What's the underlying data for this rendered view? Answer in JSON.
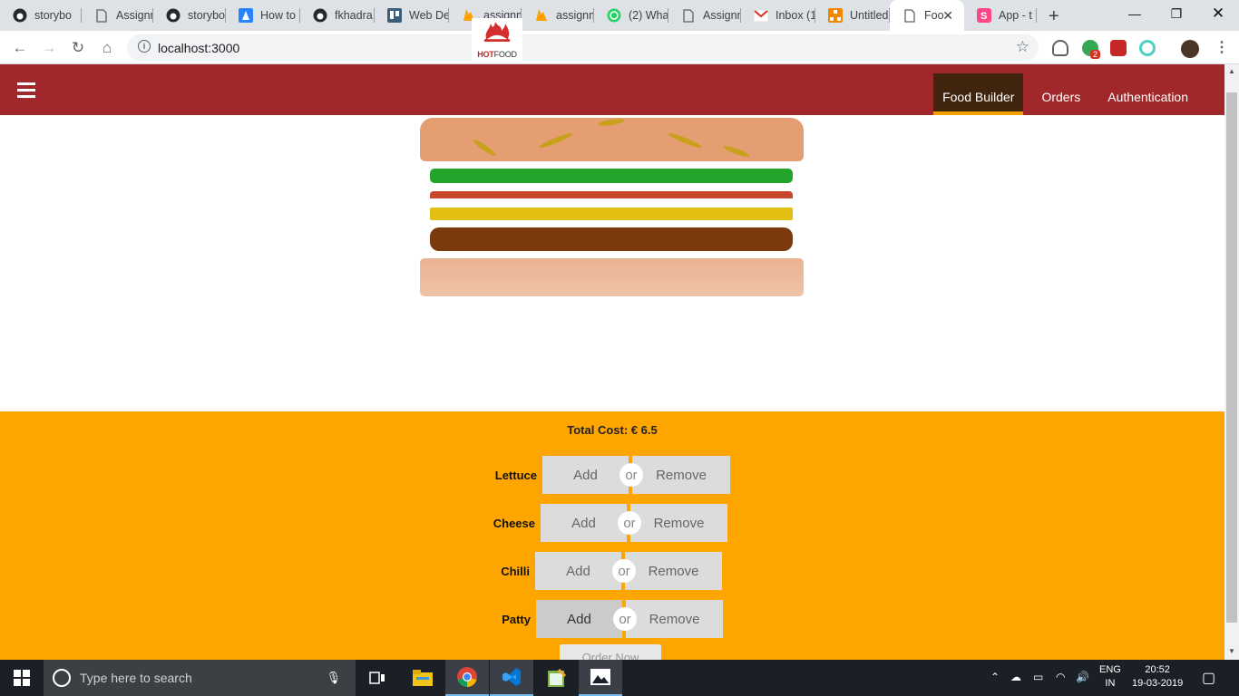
{
  "browser": {
    "tabs": [
      {
        "label": "storybo",
        "icon": "github-icon"
      },
      {
        "label": "Assignn",
        "icon": "page-icon"
      },
      {
        "label": "storybo",
        "icon": "github-icon"
      },
      {
        "label": "How to",
        "icon": "atlassian-icon"
      },
      {
        "label": "fkhadra",
        "icon": "github-icon"
      },
      {
        "label": "Web De",
        "icon": "trello-icon"
      },
      {
        "label": "assignm",
        "icon": "firebase-icon"
      },
      {
        "label": "assignm",
        "icon": "firebase-icon"
      },
      {
        "label": "(2) Wha",
        "icon": "whatsapp-icon"
      },
      {
        "label": "Assignn",
        "icon": "page-icon"
      },
      {
        "label": "Inbox (1",
        "icon": "gmail-icon"
      },
      {
        "label": "Untitled",
        "icon": "drawio-icon"
      },
      {
        "label": "Foo",
        "icon": "page-icon"
      },
      {
        "label": "App - t",
        "icon": "storybook-icon"
      }
    ],
    "new_tab": "+",
    "url": "localhost:3000",
    "extension_badge": "2"
  },
  "app": {
    "logo_hot": "HOT",
    "logo_food": "FOOD",
    "nav": [
      {
        "label": "Food Builder",
        "active": true
      },
      {
        "label": "Orders",
        "active": false
      },
      {
        "label": "Authentication",
        "active": false
      }
    ],
    "total_cost": "Total Cost: € 6.5",
    "controls": [
      {
        "label": "Lettuce",
        "add": "Add",
        "or": "or",
        "remove": "Remove"
      },
      {
        "label": "Cheese",
        "add": "Add",
        "or": "or",
        "remove": "Remove"
      },
      {
        "label": "Chilli",
        "add": "Add",
        "or": "or",
        "remove": "Remove"
      },
      {
        "label": "Patty",
        "add": "Add",
        "or": "or",
        "remove": "Remove"
      }
    ],
    "order_button": "Order Now",
    "colors": {
      "header": "#a0282b",
      "controls_bg": "#ffa500",
      "lettuce": "#22a52a",
      "chilli": "#c8472a",
      "cheese": "#e2c012",
      "patty": "#7a3a0c",
      "bread": "#e59e72"
    }
  },
  "taskbar": {
    "search_placeholder": "Type here to search",
    "lang_top": "ENG",
    "lang_bottom": "IN",
    "time": "20:52",
    "date": "19-03-2019"
  }
}
